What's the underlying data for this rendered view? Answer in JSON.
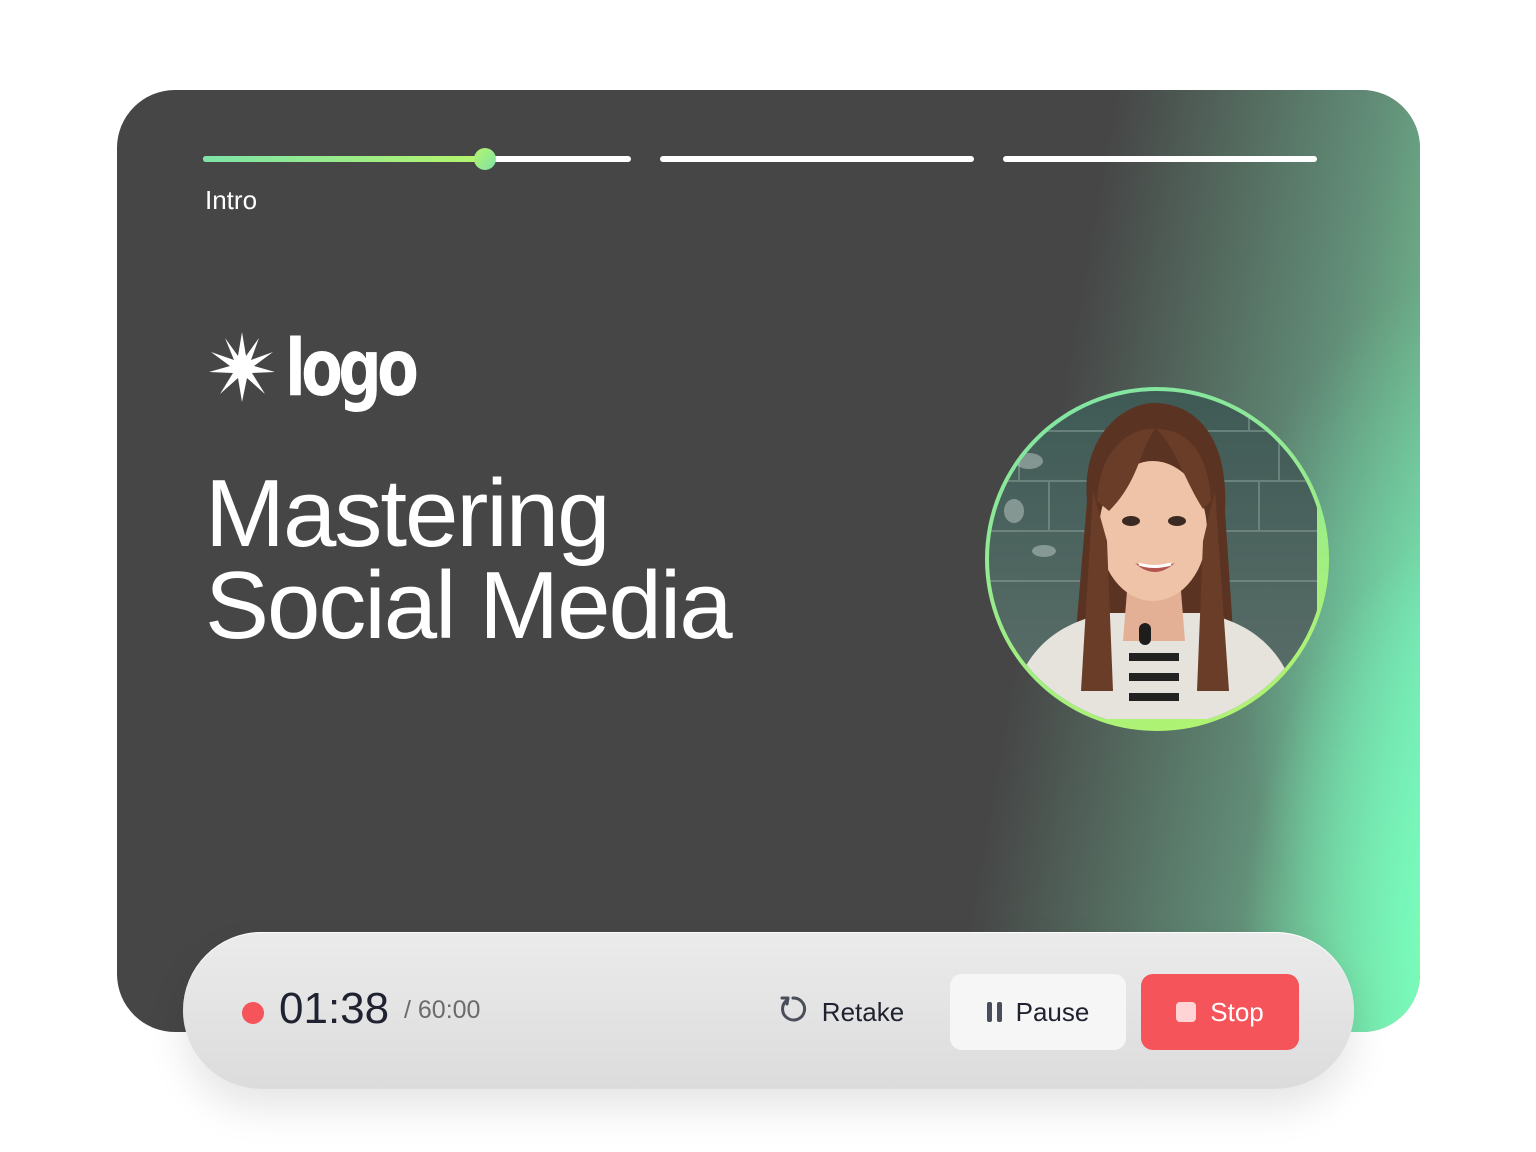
{
  "progress": {
    "segments": [
      {
        "label": "Intro",
        "fill": 0.66
      },
      {
        "label": "",
        "fill": 0
      },
      {
        "label": "",
        "fill": 0
      }
    ],
    "current_label": "Intro"
  },
  "slide": {
    "logo_text": "logo",
    "title_line1": "Mastering",
    "title_line2": "Social Media"
  },
  "toolbar": {
    "elapsed": "01:38",
    "total": "/ 60:00",
    "retake_label": "Retake",
    "pause_label": "Pause",
    "stop_label": "Stop"
  },
  "colors": {
    "accent_green": "#7de3a8",
    "accent_lime": "#b6f56b",
    "record_red": "#f4545a",
    "slide_bg": "#464646"
  },
  "icons": {
    "logo": "starburst-icon",
    "retake": "retake-icon",
    "pause": "pause-icon",
    "stop": "stop-icon",
    "recording": "record-indicator-icon"
  }
}
